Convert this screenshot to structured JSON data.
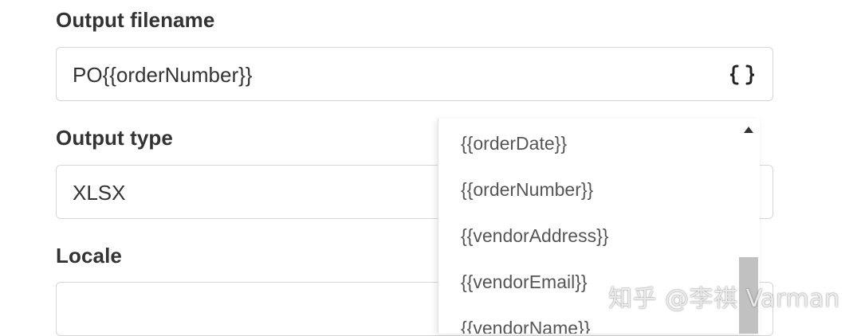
{
  "form": {
    "output_filename": {
      "label": "Output filename",
      "value": "PO{{orderNumber}}",
      "insert_variable_icon": "curly-braces-icon"
    },
    "output_type": {
      "label": "Output type",
      "value": "XLSX"
    },
    "locale": {
      "label": "Locale",
      "value": ""
    }
  },
  "variable_dropdown": {
    "items": [
      {
        "label": "{{orderDate}}"
      },
      {
        "label": "{{orderNumber}}"
      },
      {
        "label": "{{vendorAddress}}"
      },
      {
        "label": "{{vendorEmail}}"
      },
      {
        "label": "{{vendorName}}"
      }
    ]
  },
  "watermark": {
    "text": "知乎 @李祺 Varman"
  }
}
